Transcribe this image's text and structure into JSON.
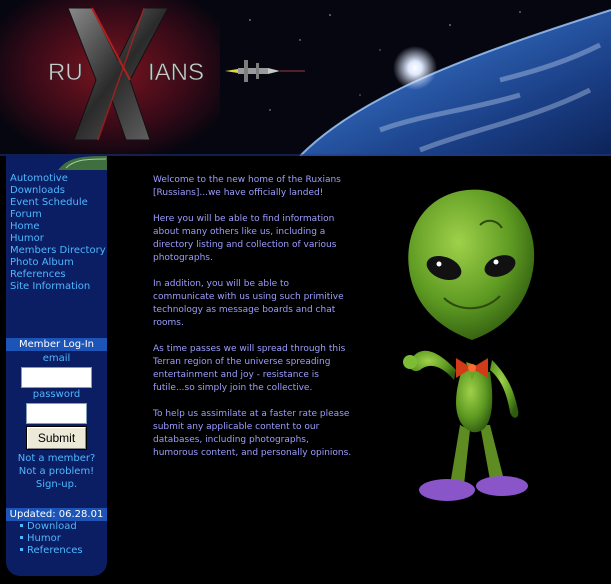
{
  "banner": {
    "logo_left": "RU",
    "logo_right": "IANS",
    "logo_center": "X"
  },
  "nav": {
    "items": [
      "Automotive",
      "Downloads",
      "Event Schedule",
      "Forum",
      "Home",
      "Humor",
      "Members Directory",
      "Photo Album",
      "References",
      "Site Information"
    ]
  },
  "login": {
    "heading": "Member Log-In",
    "email_label": "email",
    "password_label": "password",
    "email_value": "",
    "password_value": "",
    "submit_label": "Submit",
    "not_member_line1": "Not a member?",
    "not_member_line2": "Not a problem!",
    "signup_label": "Sign-up."
  },
  "updated": {
    "heading": "Updated: 06.28.01",
    "items": [
      "Download",
      "Humor",
      "References"
    ]
  },
  "content": {
    "paragraphs": [
      "Welcome to the new home of the Ruxians [Russians]...we have officially landed!",
      "Here you will be able to find information about many others like us, including a directory listing and collection of various photographs.",
      "In addition, you will be able to communicate with us using such primitive technology as message boards and chat rooms.",
      "As time passes we will spread through this Terran region of the universe spreading entertainment and joy - resistance is futile...so simply join the collective.",
      "To help us assimilate at a faster rate please submit any applicable content to our databases, including photographs, humorous content, and personally opinions."
    ]
  },
  "colors": {
    "background": "#000000",
    "sidebar": "#0c1e63",
    "section_header": "#1c55b7",
    "link": "#4db7ff",
    "content_text": "#9d9dff"
  }
}
